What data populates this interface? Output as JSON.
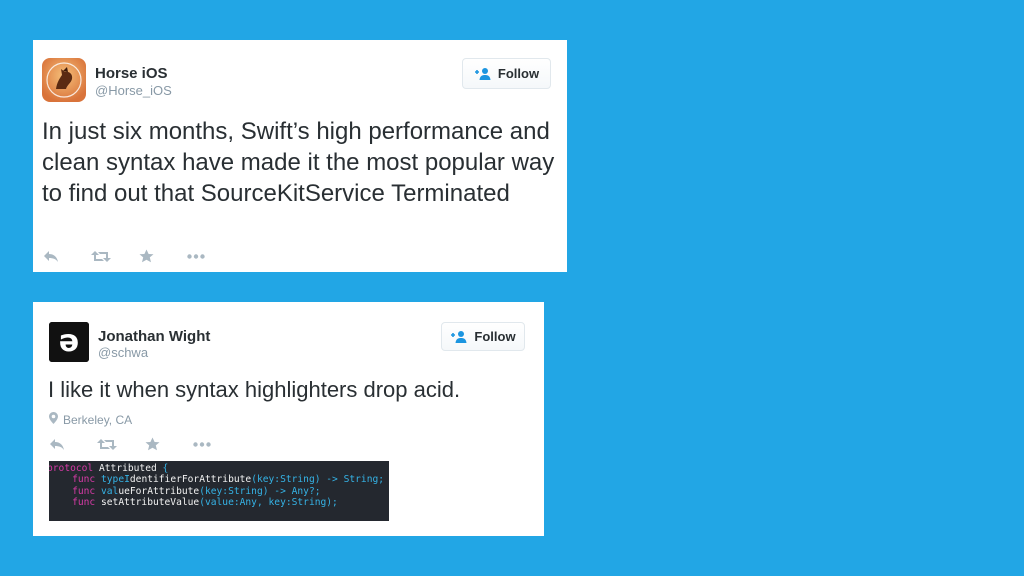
{
  "tweets": [
    {
      "name": "Horse iOS",
      "handle": "@Horse_iOS",
      "follow_label": "Follow",
      "text": "In just six months, Swift’s high performance and clean syntax have made it the most popular way to find out that SourceKitService Terminated"
    },
    {
      "name": "Jonathan Wight",
      "handle": "@schwa",
      "follow_label": "Follow",
      "text": "I like it when syntax highlighters drop acid.",
      "location": "Berkeley, CA",
      "avatar_glyph": "ə",
      "code": {
        "l1_kw": "protocol",
        "l1_name": "Attributed",
        "l1_brace": "{",
        "func_kw": "func",
        "l2_a": "typeI",
        "l2_b": "dentifierForAttribute",
        "l2_c": "(key:String) -> String;",
        "l3_a": "val",
        "l3_b": "ueForAttribute",
        "l3_c": "(key:String) -> Any?;",
        "l4_a": "setAttributeValue",
        "l4_b": "(value:Any, key:String);"
      }
    }
  ],
  "colors": {
    "background": "#22a6e5",
    "name_text": "#292f33",
    "handle_text": "#8899a6",
    "follow_icon": "#1b95e0",
    "action_icon": "#aab8c2"
  },
  "icons": [
    "horse-avatar",
    "follow-person-icon",
    "reply-icon",
    "retweet-icon",
    "favorite-star-icon",
    "more-dots-icon",
    "location-pin-icon"
  ]
}
